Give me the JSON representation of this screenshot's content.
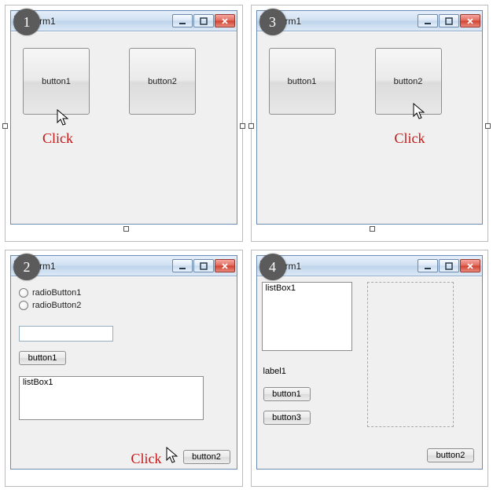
{
  "badges": {
    "p1": "1",
    "p2": "2",
    "p3": "3",
    "p4": "4"
  },
  "title": "Form1",
  "click_label": "Click",
  "panel1": {
    "button1": "button1",
    "button2": "button2"
  },
  "panel3": {
    "button1": "button1",
    "button2": "button2"
  },
  "panel2": {
    "radio1": "radioButton1",
    "radio2": "radioButton2",
    "button1": "button1",
    "listbox_item": "listBox1",
    "button2": "button2"
  },
  "panel4": {
    "listbox_item": "listBox1",
    "label1": "label1",
    "button1": "button1",
    "button3": "button3",
    "button2": "button2"
  }
}
